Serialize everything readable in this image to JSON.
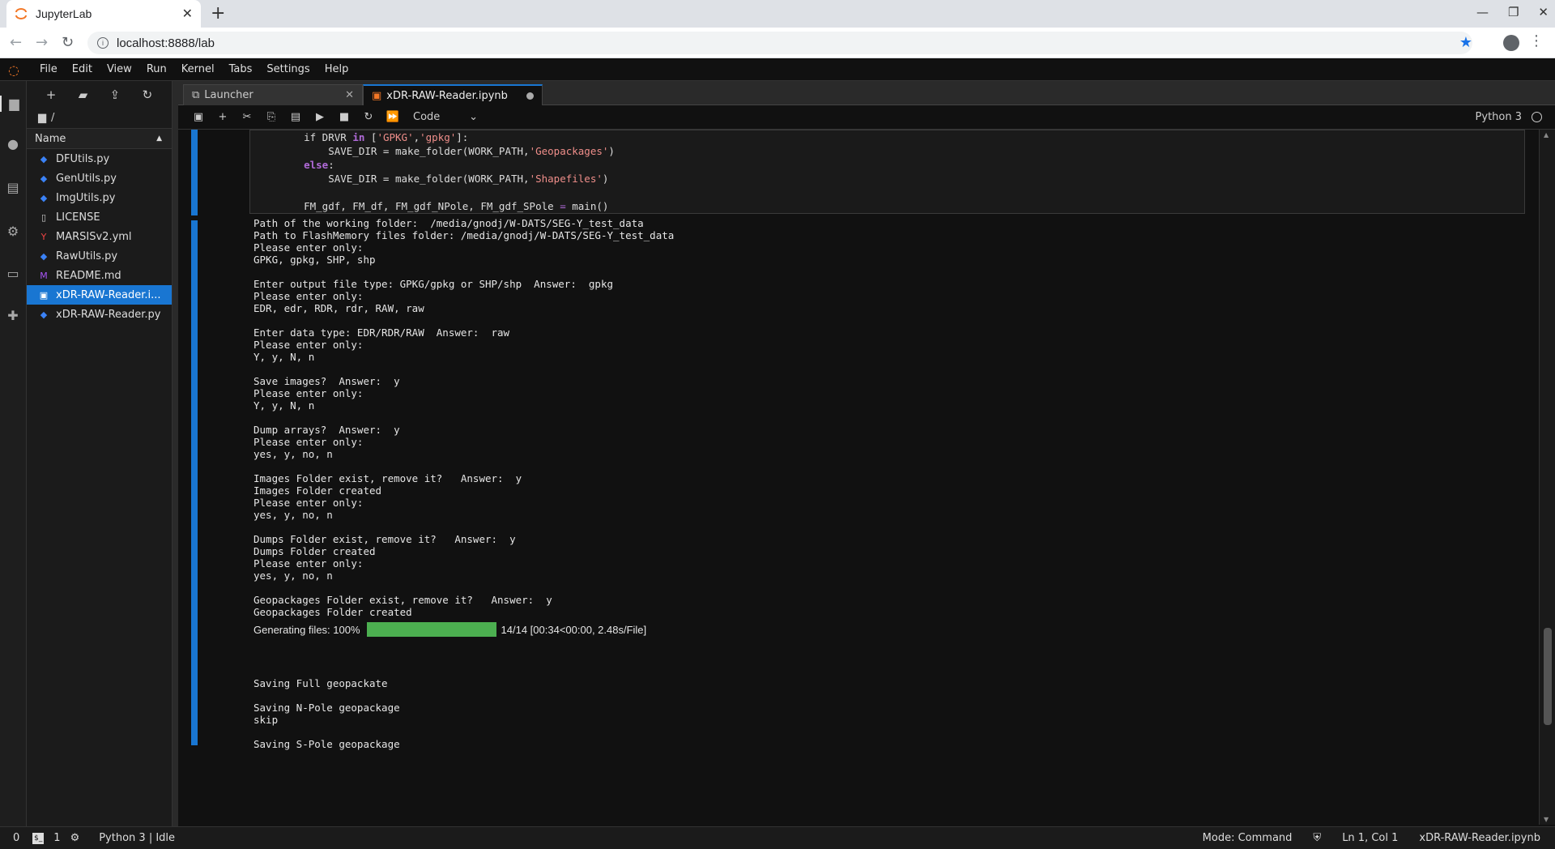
{
  "browser": {
    "tab_title": "JupyterLab",
    "tab_close": "✕",
    "new_tab": "+",
    "url": "localhost:8888/lab",
    "window_controls": [
      "—",
      "❐",
      "✕"
    ]
  },
  "menubar": {
    "items": [
      "File",
      "Edit",
      "View",
      "Run",
      "Kernel",
      "Tabs",
      "Settings",
      "Help"
    ]
  },
  "filebrowser": {
    "breadcrumb": "/",
    "header": "Name",
    "files": [
      {
        "name": "DFUtils.py",
        "type": "python"
      },
      {
        "name": "GenUtils.py",
        "type": "python"
      },
      {
        "name": "ImgUtils.py",
        "type": "python"
      },
      {
        "name": "LICENSE",
        "type": "file"
      },
      {
        "name": "MARSISv2.yml",
        "type": "yaml"
      },
      {
        "name": "RawUtils.py",
        "type": "python"
      },
      {
        "name": "README.md",
        "type": "markdown"
      },
      {
        "name": "xDR-RAW-Reader.i...",
        "type": "notebook",
        "selected": true
      },
      {
        "name": "xDR-RAW-Reader.py",
        "type": "python"
      }
    ]
  },
  "doctabs": {
    "launcher": "Launcher",
    "notebook": "xDR-RAW-Reader.ipynb"
  },
  "toolbar": {
    "cell_type": "Code",
    "kernel": "Python 3"
  },
  "code": {
    "line1_pre": "    if DRVR ",
    "line1_kw": "in",
    "line1_a": " [",
    "line1_s1": "'GPKG'",
    "line1_b": ",",
    "line1_s2": "'gpkg'",
    "line1_c": "]:",
    "line2_pre": "        SAVE_DIR = make_folder(WORK_PATH,",
    "line2_s": "'Geopackages'",
    "line2_post": ")",
    "line3_kw": "    else",
    "line3_post": ":",
    "line4_pre": "        SAVE_DIR = make_folder(WORK_PATH,",
    "line4_s": "'Shapefiles'",
    "line4_post": ")",
    "line5_pre": "    FM_gdf, FM_df, FM_gdf_NPole, FM_gdf_SPole ",
    "line5_op": "=",
    "line5_post": " main()"
  },
  "output": {
    "lines_before": [
      "Path of the working folder:  /media/gnodj/W-DATS/SEG-Y_test_data",
      "Path to FlashMemory files folder: /media/gnodj/W-DATS/SEG-Y_test_data",
      "Please enter only:",
      "GPKG, gpkg, SHP, shp",
      "",
      "Enter output file type: GPKG/gpkg or SHP/shp  Answer:  gpkg",
      "Please enter only:",
      "EDR, edr, RDR, rdr, RAW, raw",
      "",
      "Enter data type: EDR/RDR/RAW  Answer:  raw",
      "Please enter only:",
      "Y, y, N, n",
      "",
      "Save images?  Answer:  y",
      "Please enter only:",
      "Y, y, N, n",
      "",
      "Dump arrays?  Answer:  y",
      "Please enter only:",
      "yes, y, no, n",
      "",
      "Images Folder exist, remove it?   Answer:  y",
      "Images Folder created",
      "Please enter only:",
      "yes, y, no, n",
      "",
      "Dumps Folder exist, remove it?   Answer:  y",
      "Dumps Folder created",
      "Please enter only:",
      "yes, y, no, n",
      "",
      "Geopackages Folder exist, remove it?   Answer:  y",
      "Geopackages Folder created"
    ],
    "progress_label": "Generating files: 100%",
    "progress_fraction": 1.0,
    "progress_stats": "14/14 [00:34<00:00, 2.48s/File]",
    "lines_after": [
      "",
      "",
      "",
      "Saving Full geopackate",
      "",
      "Saving N-Pole geopackage",
      "skip",
      "",
      "Saving S-Pole geopackage"
    ]
  },
  "statusbar": {
    "count_a": "0",
    "count_b": "1",
    "kernel_status": "Python 3 | Idle",
    "mode": "Mode: Command",
    "cursor": "Ln 1, Col 1",
    "filename": "xDR-RAW-Reader.ipynb"
  },
  "colors": {
    "accent": "#1976d2",
    "progress": "#4caf50",
    "jupyter_orange": "#f37726"
  }
}
